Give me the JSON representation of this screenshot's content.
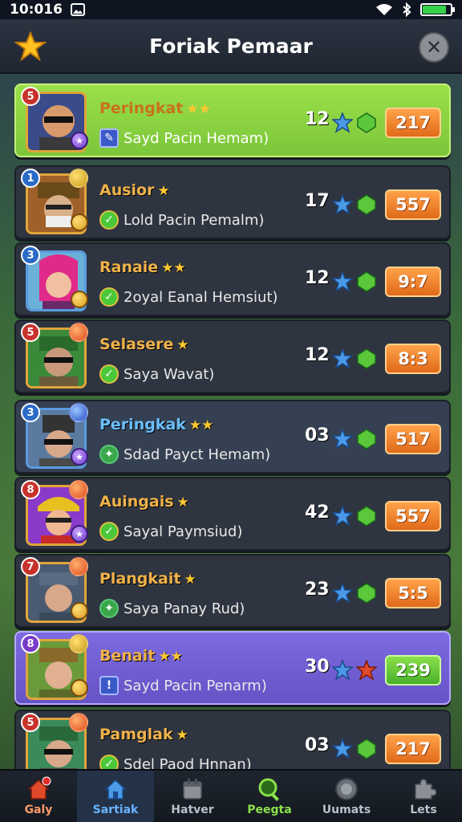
{
  "status": {
    "time": "10:016"
  },
  "header": {
    "title": "Foriak Pemaar"
  },
  "rows": [
    {
      "rank": "5",
      "name": "Peringkat",
      "stars": "★★",
      "sub": "Sayd Pacin Hemam)",
      "score": "12",
      "value": "217"
    },
    {
      "rank": "1",
      "name": "Ausior",
      "stars": "★",
      "sub": "Lold Pacin Pemalm)",
      "score": "17",
      "value": "557"
    },
    {
      "rank": "3",
      "name": "Ranaie",
      "stars": "★★",
      "sub": "2oyal Eanal Hemsiut)",
      "score": "12",
      "value": "9:7"
    },
    {
      "rank": "5",
      "name": "Selasere",
      "stars": "★",
      "sub": "Saya Wavat)",
      "score": "12",
      "value": "8:3"
    },
    {
      "rank": "3",
      "name": "Peringkak",
      "stars": "★★",
      "sub": "Sdad Payct Hemam)",
      "score": "03",
      "value": "517"
    },
    {
      "rank": "8",
      "name": "Auingais",
      "stars": "★",
      "sub": "Sayal Paymsiud)",
      "score": "42",
      "value": "557"
    },
    {
      "rank": "7",
      "name": "Plangkait",
      "stars": "★",
      "sub": "Saya Panay Rud)",
      "score": "23",
      "value": "5:5"
    },
    {
      "rank": "8",
      "name": "Benait",
      "stars": "★★",
      "sub": "Sayd Pacin Penarm)",
      "score": "30",
      "value": "239"
    },
    {
      "rank": "5",
      "name": "Pamglak",
      "stars": "★",
      "sub": "Sdel Paod Hnnan)",
      "score": "03",
      "value": "217"
    }
  ],
  "nav": [
    {
      "label": "Galy"
    },
    {
      "label": "Sartiak"
    },
    {
      "label": "Hatver"
    },
    {
      "label": "Peegta"
    },
    {
      "label": "Uumats"
    },
    {
      "label": "Lets"
    }
  ]
}
